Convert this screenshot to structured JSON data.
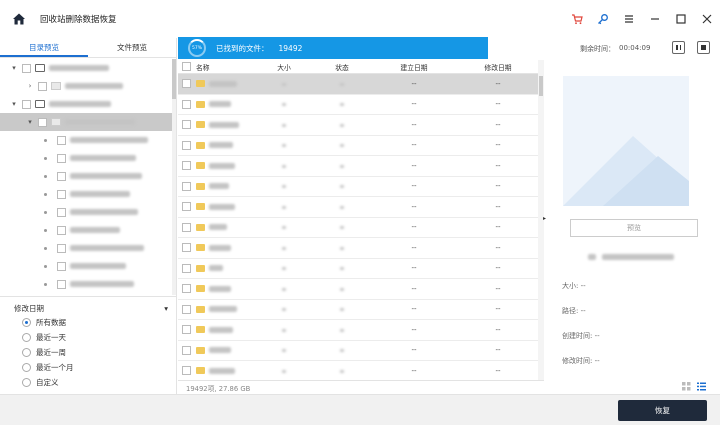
{
  "app": {
    "title": "回收站删除数据恢复"
  },
  "colors": {
    "accent": "#1d6fd0",
    "progress_bar": "#1597e5",
    "cart_icon": "#e0463b",
    "key_icon": "#1d6fd0",
    "recover_button": "#1f2a3b"
  },
  "left": {
    "tabs": [
      "目录预览",
      "文件预览"
    ],
    "filter": {
      "title": "修改日期",
      "options": [
        {
          "label": "所有数据",
          "selected": true
        },
        {
          "label": "最近一天",
          "selected": false
        },
        {
          "label": "最近一周",
          "selected": false
        },
        {
          "label": "最近一个月",
          "selected": false
        },
        {
          "label": "自定义",
          "selected": false
        }
      ]
    }
  },
  "scan": {
    "percent": "57%",
    "found_label": "已找到的文件：",
    "found_count": "19492",
    "timer_label": "剩余时间：",
    "timer_value": "00:04:09"
  },
  "table": {
    "headers": {
      "name": "名称",
      "size": "大小",
      "status": "状态",
      "created": "建立日期",
      "modified": "修改日期"
    },
    "row_created": "--",
    "row_modified": "--",
    "row_status": "--"
  },
  "statusbar": {
    "summary": "19492项, 27.86 GB"
  },
  "preview": {
    "button": "预览",
    "size_label": "大小:",
    "path_label": "路径:",
    "created_label": "创建时间:",
    "modified_label": "修改时间:",
    "empty_value": "--"
  },
  "footer": {
    "recover": "恢复"
  }
}
